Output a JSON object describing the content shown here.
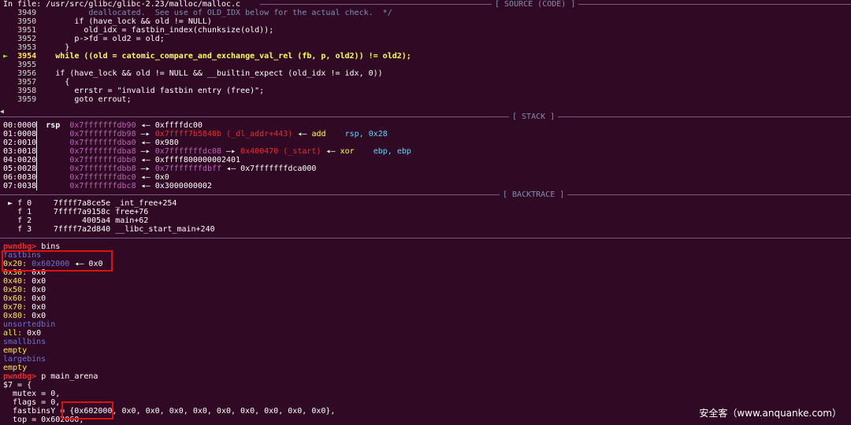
{
  "source": {
    "file_line": "In file: /usr/src/glibc/glibc-2.23/malloc/malloc.c",
    "banner": "[ SOURCE (CODE) ]",
    "lines": [
      {
        "no": "3949",
        "code": "          deallocated.  See use of OLD_IDX below for the actual check.  */"
      },
      {
        "no": "3950",
        "code": "       if (have_lock && old != NULL)"
      },
      {
        "no": "3951",
        "code": "         old_idx = fastbin_index(chunksize(old));"
      },
      {
        "no": "3952",
        "code": "       p->fd = old2 = old;"
      },
      {
        "no": "3953",
        "code": "     }"
      },
      {
        "no": "3954",
        "code": "   while ((old = catomic_compare_and_exchange_val_rel (fb, p, old2)) != old2);",
        "current": true
      },
      {
        "no": "3955",
        "code": ""
      },
      {
        "no": "3956",
        "code": "   if (have_lock && old != NULL && __builtin_expect (old_idx != idx, 0))"
      },
      {
        "no": "3957",
        "code": "     {"
      },
      {
        "no": "3958",
        "code": "       errstr = \"invalid fastbin entry (free)\";"
      },
      {
        "no": "3959",
        "code": "       goto errout;"
      }
    ],
    "current_marker": "►"
  },
  "stack": {
    "banner": "[ STACK ]",
    "rows": [
      {
        "off": "00:0000",
        "reg": "rsp",
        "addr": "0x7fffffffdb90",
        "chain": "◂— 0xffffdc00"
      },
      {
        "off": "01:0008",
        "reg": "",
        "addr": "0x7fffffffdb98",
        "arrow": "—▸",
        "target": "0x7ffff7b5840b (_dl_addr+443)",
        "arrow2": "◂—",
        "ins": "add",
        "ops": "rsp, 0x28"
      },
      {
        "off": "02:0010",
        "reg": "",
        "addr": "0x7fffffffdba0",
        "chain": "◂— 0x980"
      },
      {
        "off": "03:0018",
        "reg": "",
        "addr": "0x7fffffffdba8",
        "arrow": "—▸",
        "target": "0x7fffffffdc08",
        "arrow2": "—▸",
        "target2": "0x400470 (_start)",
        "arrow3": "◂—",
        "ins": "xor",
        "ops": "ebp, ebp"
      },
      {
        "off": "04:0020",
        "reg": "",
        "addr": "0x7fffffffdbb0",
        "chain": "◂— 0xffff800000002401"
      },
      {
        "off": "05:0028",
        "reg": "",
        "addr": "0x7fffffffdbb8",
        "arrow": "—▸",
        "target": "0x7fffffffdbff",
        "chain": "◂— 0x7fffffffdca000"
      },
      {
        "off": "06:0030",
        "reg": "",
        "addr": "0x7fffffffdbc0",
        "chain": "◂— 0x0"
      },
      {
        "off": "07:0038",
        "reg": "",
        "addr": "0x7fffffffdbc8",
        "chain": "◂— 0x3000000002"
      }
    ]
  },
  "backtrace": {
    "banner": "[ BACKTRACE ]",
    "frames": [
      {
        "marker": "►",
        "frame": "f 0",
        "addr": "7ffff7a8ce5e",
        "sym": "_int_free+254"
      },
      {
        "marker": "",
        "frame": "f 1",
        "addr": "7ffff7a9158c",
        "sym": "free+76"
      },
      {
        "marker": "",
        "frame": "f 2",
        "addr": "4005a4",
        "sym": "main+62"
      },
      {
        "marker": "",
        "frame": "f 3",
        "addr": "7ffff7a2d840",
        "sym": "__libc_start_main+240"
      }
    ]
  },
  "bins": {
    "prompt": "pwndbg>",
    "command": "bins",
    "fastbins_label": "fastbins",
    "fastbins": [
      {
        "size": "0x20:",
        "value": "0x602000",
        "arrow": "◂—",
        "tail": "0x0"
      },
      {
        "size": "0x30:",
        "value": "0x0"
      },
      {
        "size": "0x40:",
        "value": "0x0"
      },
      {
        "size": "0x50:",
        "value": "0x0"
      },
      {
        "size": "0x60:",
        "value": "0x0"
      },
      {
        "size": "0x70:",
        "value": "0x0"
      },
      {
        "size": "0x80:",
        "value": "0x0"
      }
    ],
    "unsortedbin_label": "unsortedbin",
    "unsorted_all": "all:",
    "unsorted_value": "0x0",
    "smallbins_label": "smallbins",
    "smallbins_value": "empty",
    "largebins_label": "largebins",
    "largebins_value": "empty"
  },
  "arena": {
    "prompt": "pwndbg>",
    "command": "p main_arena",
    "lines": [
      "$7 = {",
      "  mutex = 0,",
      "  flags = 0,",
      "  fastbinsY = {0x602000, 0x0, 0x0, 0x0, 0x0, 0x0, 0x0, 0x0, 0x0, 0x0},",
      "  top = 0x602060,"
    ]
  },
  "watermark": "安全客（www.anquanke.com）",
  "colors": {
    "background": "#300a24",
    "highlight_box": "#e01010",
    "current_line": "#ffff55",
    "pointer": "#ef2929",
    "prompt": "#ef2929"
  }
}
